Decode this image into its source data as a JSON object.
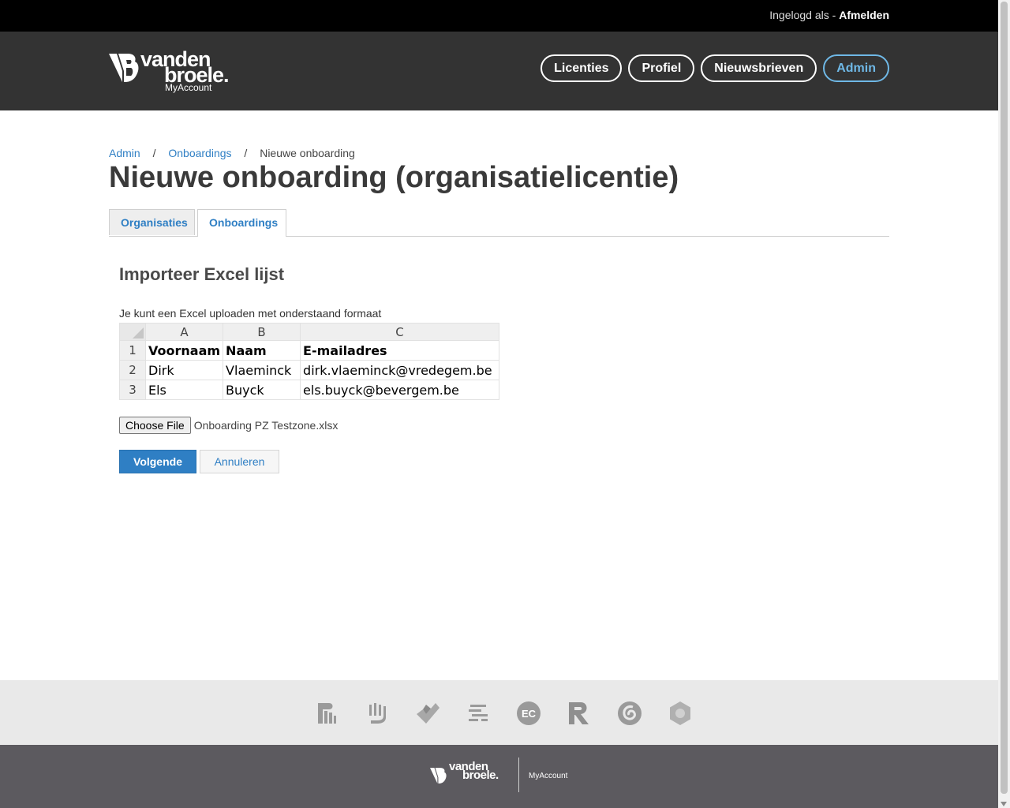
{
  "topbar": {
    "logged_in_as": "Ingelogd als -",
    "logout": "Afmelden"
  },
  "header": {
    "logo": {
      "line1": "vanden",
      "line2": "broele.",
      "subtitle": "MyAccount"
    },
    "nav": [
      {
        "label": "Licenties"
      },
      {
        "label": "Profiel"
      },
      {
        "label": "Nieuwsbrieven"
      },
      {
        "label": "Admin",
        "active": true
      }
    ]
  },
  "breadcrumb": {
    "items": [
      "Admin",
      "Onboardings",
      "Nieuwe onboarding"
    ],
    "separator": "/"
  },
  "page_title": "Nieuwe onboarding (organisatielicentie)",
  "tabs": [
    {
      "label": "Organisaties"
    },
    {
      "label": "Onboardings",
      "active": true
    }
  ],
  "import": {
    "heading": "Importeer Excel lijst",
    "description": "Je kunt een Excel uploaden met onderstaand formaat",
    "excel": {
      "columns": [
        "A",
        "B",
        "C"
      ],
      "rows": [
        {
          "num": "1",
          "cells": [
            "Voornaam",
            "Naam",
            "E-mailadres"
          ]
        },
        {
          "num": "2",
          "cells": [
            "Dirk",
            "Vlaeminck",
            "dirk.vlaeminck@vredegem.be"
          ]
        },
        {
          "num": "3",
          "cells": [
            "Els",
            "Buyck",
            "els.buyck@bevergem.be"
          ]
        }
      ]
    },
    "choose_file": "Choose File",
    "file_name": "Onboarding PZ Testzone.xlsx",
    "next": "Volgende",
    "cancel": "Annuleren"
  },
  "footer": {
    "brand_icons": [
      "brand-politeia-icon",
      "brand-die-keure-icon",
      "brand-check-icon",
      "brand-lines-icon",
      "brand-ec-icon",
      "brand-r-icon",
      "brand-spiral-icon",
      "brand-hexagon-icon"
    ],
    "brand_ec_text": "EC",
    "logo": {
      "line1": "vanden",
      "line2": "broele."
    },
    "myaccount": "MyAccount"
  },
  "colors": {
    "header_bg": "#333333",
    "accent": "#2f7fc4",
    "nav_active": "#6fb8e6",
    "footer_bg": "#5c5a5f"
  }
}
